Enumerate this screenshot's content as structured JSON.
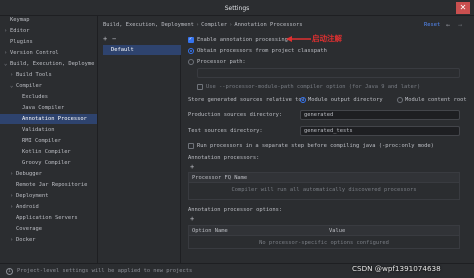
{
  "window": {
    "title": "Settings",
    "close": "✕"
  },
  "sidebar": {
    "items": [
      {
        "label": "Keymap",
        "arrow": "",
        "indent": 0
      },
      {
        "label": "Editor",
        "arrow": "›",
        "indent": 0
      },
      {
        "label": "Plugins",
        "arrow": "",
        "indent": 0
      },
      {
        "label": "Version Control",
        "arrow": "›",
        "indent": 0
      },
      {
        "label": "Build, Execution, Deployme",
        "arrow": "⌄",
        "indent": 0
      },
      {
        "label": "Build Tools",
        "arrow": "›",
        "indent": 1
      },
      {
        "label": "Compiler",
        "arrow": "⌄",
        "indent": 1
      },
      {
        "label": "Excludes",
        "arrow": "",
        "indent": 2
      },
      {
        "label": "Java Compiler",
        "arrow": "",
        "indent": 2
      },
      {
        "label": "Annotation Processor",
        "arrow": "",
        "indent": 2,
        "selected": true
      },
      {
        "label": "Validation",
        "arrow": "",
        "indent": 2
      },
      {
        "label": "RMI Compiler",
        "arrow": "",
        "indent": 2
      },
      {
        "label": "Kotlin Compiler",
        "arrow": "",
        "indent": 2
      },
      {
        "label": "Groovy Compiler",
        "arrow": "",
        "indent": 2
      },
      {
        "label": "Debugger",
        "arrow": "›",
        "indent": 1
      },
      {
        "label": "Remote Jar Repositorie",
        "arrow": "",
        "indent": 1
      },
      {
        "label": "Deployment",
        "arrow": "›",
        "indent": 1
      },
      {
        "label": "Android",
        "arrow": "›",
        "indent": 1
      },
      {
        "label": "Application Servers",
        "arrow": "",
        "indent": 1
      },
      {
        "label": "Coverage",
        "arrow": "",
        "indent": 1
      },
      {
        "label": "Docker",
        "arrow": "›",
        "indent": 1
      }
    ]
  },
  "breadcrumb": {
    "parts": [
      "Build, Execution, Deployment",
      "Compiler",
      "Annotation Processors"
    ],
    "separator": "›"
  },
  "header": {
    "reset_label": "Reset",
    "back": "←",
    "forward": "→"
  },
  "profiles": {
    "add": "+",
    "remove": "−",
    "items": [
      "Default"
    ]
  },
  "form": {
    "enable_processing": "Enable annotation processing",
    "annotation_cn": "启动注解",
    "obtain_from_classpath": "Obtain processors from project classpath",
    "processor_path_label": "Processor path:",
    "module_path_option": "Use --processor-module-path compiler option (for Java 9 and later)",
    "store_sources_label": "Store generated sources relative to:",
    "module_output_dir": "Module output directory",
    "module_content_root": "Module content root",
    "prod_sources_label": "Production sources directory:",
    "prod_sources_value": "generated",
    "test_sources_label": "Test sources directory:",
    "test_sources_value": "generated_tests",
    "run_separate_step": "Run processors in a separate step before compiling java (-proc:only mode)",
    "processors_label": "Annotation processors:",
    "processors_add": "+",
    "processor_fq_header": "Processor FQ Name",
    "processors_empty": "Compiler will run all automatically discovered processors",
    "options_label": "Annotation processor options:",
    "options_add": "+",
    "option_name_header": "Option Name",
    "value_header": "Value",
    "options_empty": "No processor-specific options configured"
  },
  "footer": {
    "info": "i",
    "message": "Project-level settings will be applied to new projects"
  },
  "watermark": "CSDN @wpf1391074638",
  "colors": {
    "accent": "#3574f0",
    "selection": "#2e436e",
    "link": "#548af7",
    "annotation": "#e03030"
  }
}
